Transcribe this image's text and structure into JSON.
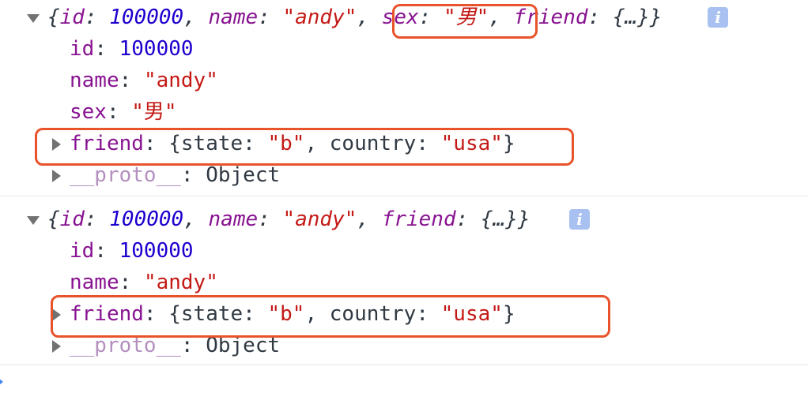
{
  "groups": [
    {
      "summary": {
        "open": "{",
        "fields": [
          {
            "key": "id",
            "sep": ": ",
            "value": "100000",
            "type": "num",
            "trail": ", "
          },
          {
            "key": "name",
            "sep": ": ",
            "value": "\"andy\"",
            "type": "str",
            "trail": ", "
          },
          {
            "key": "sex",
            "sep": ": ",
            "value": "\"男\"",
            "type": "str",
            "trail": ", "
          },
          {
            "key": "friend",
            "sep": ": ",
            "value": "{…}",
            "type": "plain",
            "trail": ""
          }
        ],
        "close": "}"
      },
      "info_icon": "i",
      "rows": [
        {
          "key": "id",
          "sep": ": ",
          "value": "100000",
          "type": "num"
        },
        {
          "key": "name",
          "sep": ": ",
          "value": "\"andy\"",
          "type": "str"
        },
        {
          "key": "sex",
          "sep": ": ",
          "value": "\"男\"",
          "type": "str"
        }
      ],
      "friend_row": {
        "key": "friend",
        "sep": ": ",
        "open": "{",
        "state_key": "state",
        "state_val": "\"b\"",
        "comma": ", ",
        "country_key": "country",
        "country_val": "\"usa\"",
        "close": "}"
      },
      "proto_row": {
        "key": "__proto__",
        "sep": ": ",
        "value": "Object"
      }
    },
    {
      "summary": {
        "open": "{",
        "fields": [
          {
            "key": "id",
            "sep": ": ",
            "value": "100000",
            "type": "num",
            "trail": ", "
          },
          {
            "key": "name",
            "sep": ": ",
            "value": "\"andy\"",
            "type": "str",
            "trail": ", "
          },
          {
            "key": "friend",
            "sep": ": ",
            "value": "{…}",
            "type": "plain",
            "trail": ""
          }
        ],
        "close": "}"
      },
      "info_icon": "i",
      "rows": [
        {
          "key": "id",
          "sep": ": ",
          "value": "100000",
          "type": "num"
        },
        {
          "key": "name",
          "sep": ": ",
          "value": "\"andy\"",
          "type": "str"
        }
      ],
      "friend_row": {
        "key": "friend",
        "sep": ": ",
        "open": "{",
        "state_key": "state",
        "state_val": "\"b\"",
        "comma": ", ",
        "country_key": "country",
        "country_val": "\"usa\"",
        "close": "}"
      },
      "proto_row": {
        "key": "__proto__",
        "sep": ": ",
        "value": "Object"
      }
    }
  ],
  "colors": {
    "key": "#881391",
    "number": "#1c00cf",
    "string": "#c41a16",
    "highlight": "#e8532b",
    "info": "#a8c1f0"
  },
  "icons": {
    "expanded": "triangle-down-icon",
    "collapsed": "triangle-right-icon",
    "info": "info-icon",
    "prompt": "chevron-right-icon"
  }
}
